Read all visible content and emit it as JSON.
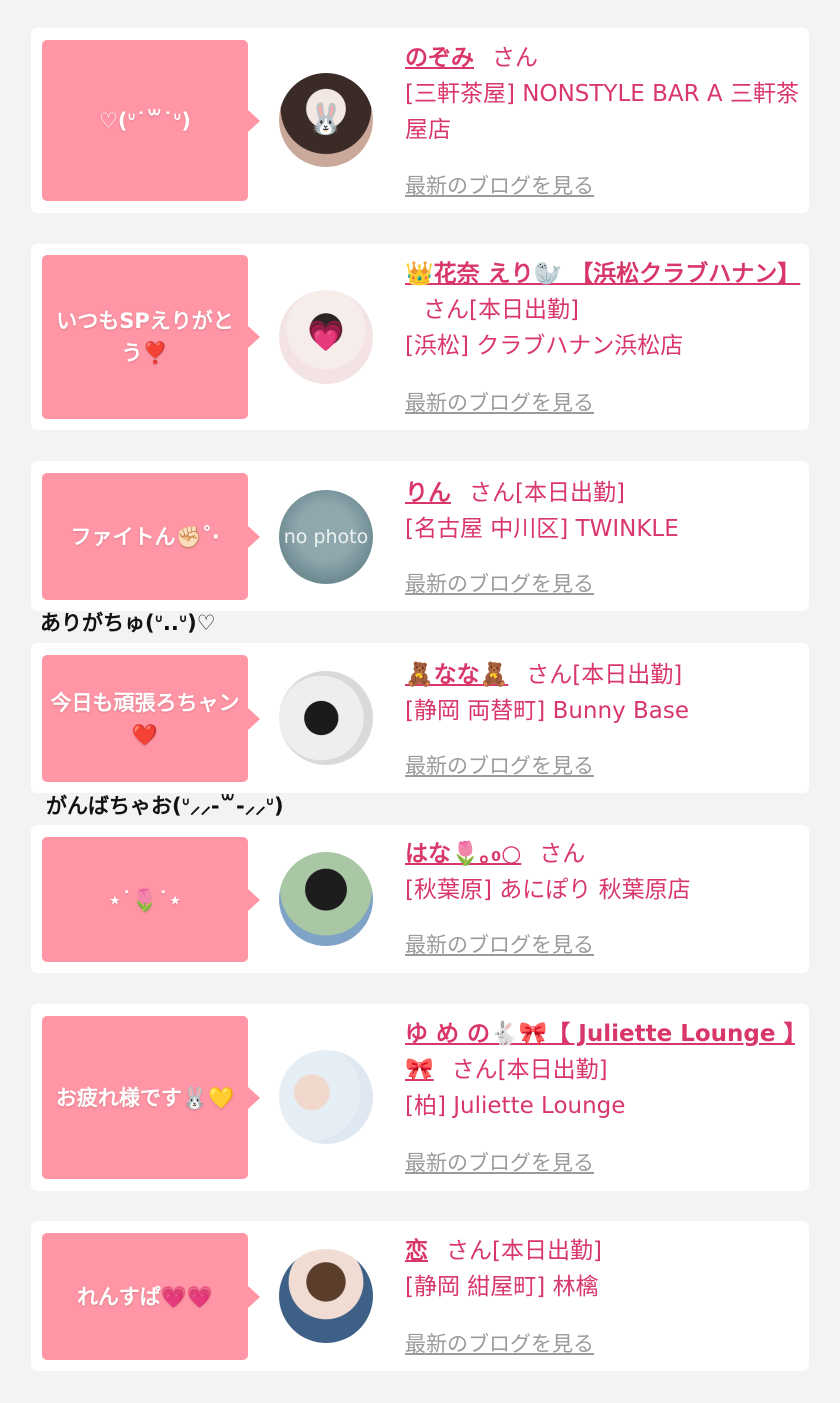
{
  "items": [
    {
      "message": "♡(ᐡ˙꒳˙ᐡ)",
      "name": "のぞみ",
      "suffix": "さん",
      "status": "",
      "shop": "[三軒茶屋] NONSTYLE BAR A 三軒茶屋店",
      "blog": "最新のブログを見る",
      "avatar_sticker": "🐰"
    },
    {
      "message": "いつもSPえりがとう❣️",
      "name": "👑花奈 えり🦭 【浜松クラブハナン】",
      "suffix": "さん",
      "status": "[本日出勤]",
      "shop": "[浜松] クラブハナン浜松店",
      "blog": "最新のブログを見る",
      "avatar_sticker": "💗"
    },
    {
      "message": "ファイトん✊🏻˚‧",
      "name": "りん",
      "suffix": "さん",
      "status": "[本日出勤]",
      "shop": "[名古屋 中川区] TWINKLE",
      "blog": "最新のブログを見る",
      "avatar_text": "no photo"
    },
    {
      "message": "今日も頑張ろちャン❤️",
      "name": "🧸なな🧸",
      "suffix": "さん",
      "status": "[本日出勤]",
      "shop": "[静岡 両替町] Bunny Base",
      "blog": "最新のブログを見る",
      "avatar_sticker": ""
    },
    {
      "message": "⋆˙🌷˙⋆",
      "name": "はな🌷｡₀○",
      "suffix": "さん",
      "status": "",
      "shop": "[秋葉原] あにぽり 秋葉原店",
      "blog": "最新のブログを見る",
      "avatar_sticker": ""
    },
    {
      "message": "お疲れ様です🐰💛",
      "name": "ゆ め の🐇🎀【 Juliette Lounge 】🎀",
      "suffix": "さん",
      "status": "[本日出勤]",
      "shop": "[柏] Juliette Lounge",
      "blog": "最新のブログを見る",
      "avatar_sticker": ""
    },
    {
      "message": "れんすぱ💗💗",
      "name": "恋",
      "suffix": "さん",
      "status": "[本日出勤]",
      "shop": "[静岡 紺屋町] 林檎",
      "blog": "最新のブログを見る",
      "avatar_sticker": ""
    }
  ],
  "overlays": {
    "text1": "ありがちゅ(ᐡ..ᐡ)♡",
    "text2": "がんばちゃお(ᐡ⸝⸝-꒳-⸝⸝ᐡ)"
  },
  "colors": {
    "bubble": "#ff95a5",
    "link": "#d9376a",
    "blog": "#9b9b9b",
    "background": "#f3f3f3"
  }
}
